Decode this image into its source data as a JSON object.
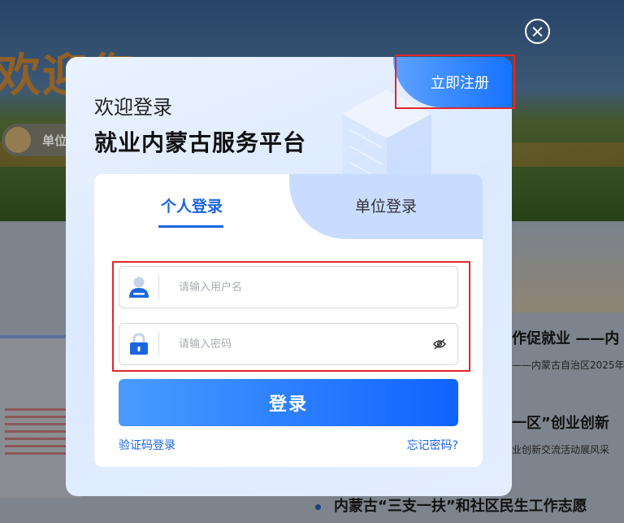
{
  "background": {
    "welcome_text": "欢迎您",
    "unit_chip_label": "单位",
    "news": [
      {
        "headline": "作促就业 ——内",
        "sub": "——内蒙古自治区2025年"
      },
      {
        "headline": "一区”创业创新",
        "sub": "业创新交流活动展风采"
      }
    ],
    "bottom_headline": "内蒙古“三支一扶”和社区民生工作志愿"
  },
  "close": {
    "icon": "close-icon"
  },
  "modal": {
    "register_label": "立即注册",
    "welcome": "欢迎登录",
    "platform_title": "就业内蒙古服务平台",
    "tabs": [
      {
        "label": "个人登录",
        "active": true
      },
      {
        "label": "单位登录",
        "active": false
      }
    ],
    "username": {
      "placeholder": "请输入用户名",
      "value": "",
      "icon": "user-icon"
    },
    "password": {
      "placeholder": "请输入密码",
      "value": "",
      "icon": "lock-icon",
      "toggle_icon": "eye-off-icon"
    },
    "login_button": "登录",
    "sms_login_link": "验证码登录",
    "forgot_link": "忘记密码?"
  },
  "colors": {
    "accent": "#1a66e0",
    "button_start": "#4a9cff",
    "button_end": "#0f63ff",
    "highlight": "#e3262a"
  }
}
